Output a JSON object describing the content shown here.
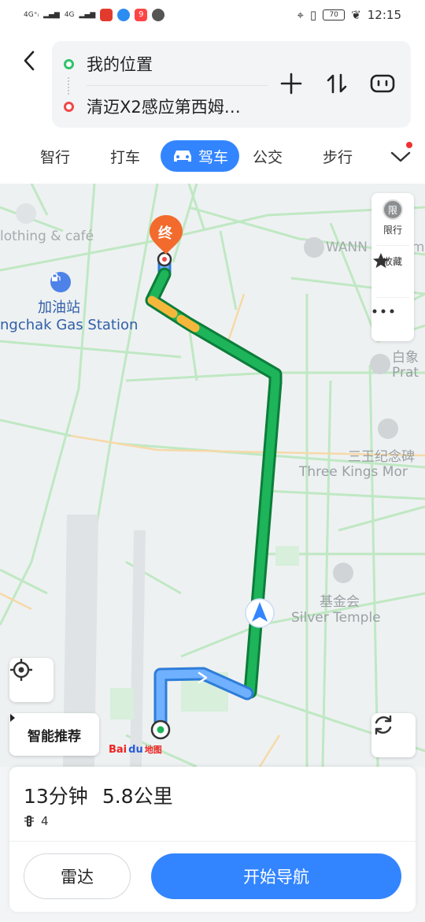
{
  "status_bar": {
    "network_1": "4G⁺ᵢ",
    "network_2": "4G",
    "time": "12:15",
    "battery": "70",
    "app_notif_badge": "9"
  },
  "header": {
    "start_label": "我的位置",
    "end_label": "清迈X2感应第西姆…"
  },
  "tabs": [
    {
      "label": "智行"
    },
    {
      "label": "打车"
    },
    {
      "label": "驾车"
    },
    {
      "label": "公交"
    },
    {
      "label": "步行"
    }
  ],
  "map": {
    "destination_marker": "终",
    "labels": {
      "clothing": "lothing & café",
      "gas_cn": "加油站",
      "gas_en": "ngchak Gas Station",
      "wann": "WANN",
      "wann_tail": "sm",
      "baixiang_cn": "白象",
      "baixiang_en": "Prat",
      "three_kings_cn": "三王纪念碑",
      "three_kings_en": "Three Kings Mor",
      "silver_cn": "基金会",
      "silver_en": "Silver Temple"
    },
    "side_panel": {
      "limit_label": "限行",
      "limit_icon_text": "限",
      "favorite_label": "收藏"
    },
    "smart_recommend": "智能推荐",
    "logo_text": "Bai",
    "logo_du": "du",
    "logo_map": "地图"
  },
  "route_summary": {
    "duration": "13分钟",
    "distance": "5.8公里",
    "traffic_lights": "4"
  },
  "buttons": {
    "radar": "雷达",
    "start_navigation": "开始导航"
  },
  "colors": {
    "accent": "#3385ff",
    "route_green": "#1db45a",
    "route_yellow": "#f5b73b",
    "destination_orange": "#f26b2d"
  }
}
